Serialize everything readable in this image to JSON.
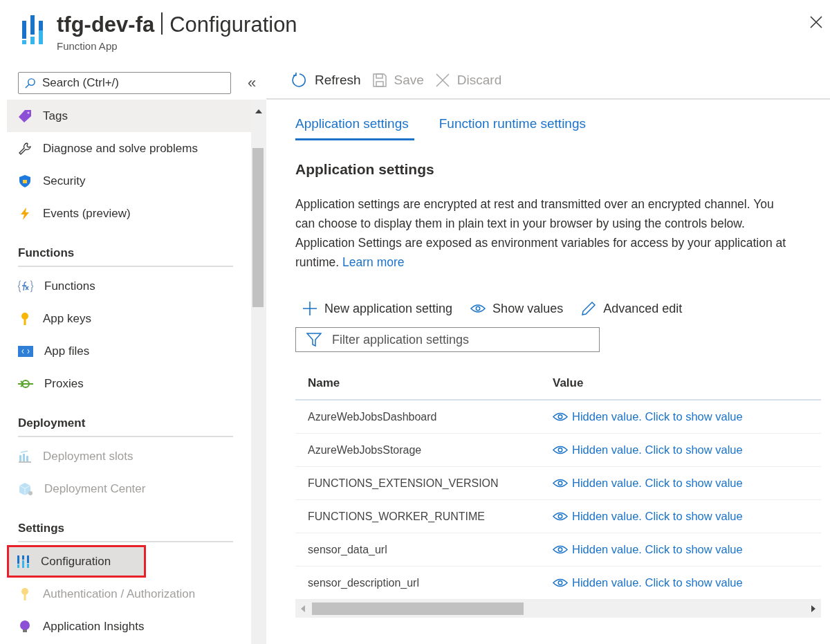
{
  "header": {
    "resource_name": "tfg-dev-fa",
    "page_title": "Configuration",
    "subtitle": "Function App"
  },
  "sidebar": {
    "search": {
      "placeholder": "Search (Ctrl+/)"
    },
    "collapse": "«",
    "items": [
      {
        "kind": "item",
        "label": "Tags",
        "disabled": false,
        "selected": false,
        "highlighted": false,
        "hovered": true
      },
      {
        "kind": "item",
        "label": "Diagnose and solve problems",
        "disabled": false,
        "selected": false,
        "highlighted": false,
        "hovered": false
      },
      {
        "kind": "item",
        "label": "Security",
        "disabled": false,
        "selected": false,
        "highlighted": false,
        "hovered": false
      },
      {
        "kind": "item",
        "label": "Events (preview)",
        "disabled": false,
        "selected": false,
        "highlighted": false,
        "hovered": false
      },
      {
        "kind": "heading",
        "label": "Functions"
      },
      {
        "kind": "item",
        "label": "Functions",
        "disabled": false,
        "selected": false,
        "highlighted": false,
        "hovered": false
      },
      {
        "kind": "item",
        "label": "App keys",
        "disabled": false,
        "selected": false,
        "highlighted": false,
        "hovered": false
      },
      {
        "kind": "item",
        "label": "App files",
        "disabled": false,
        "selected": false,
        "highlighted": false,
        "hovered": false
      },
      {
        "kind": "item",
        "label": "Proxies",
        "disabled": false,
        "selected": false,
        "highlighted": false,
        "hovered": false
      },
      {
        "kind": "heading",
        "label": "Deployment"
      },
      {
        "kind": "item",
        "label": "Deployment slots",
        "disabled": true,
        "selected": false,
        "highlighted": false,
        "hovered": false
      },
      {
        "kind": "item",
        "label": "Deployment Center",
        "disabled": true,
        "selected": false,
        "highlighted": false,
        "hovered": false
      },
      {
        "kind": "heading",
        "label": "Settings"
      },
      {
        "kind": "item",
        "label": "Configuration",
        "disabled": false,
        "selected": true,
        "highlighted": true,
        "hovered": false
      },
      {
        "kind": "item",
        "label": "Authentication / Authorization",
        "disabled": true,
        "selected": false,
        "highlighted": false,
        "hovered": false
      },
      {
        "kind": "item",
        "label": "Application Insights",
        "disabled": false,
        "selected": false,
        "highlighted": false,
        "hovered": false
      }
    ]
  },
  "toolbar": [
    {
      "label": "Refresh",
      "disabled": false
    },
    {
      "label": "Save",
      "disabled": true
    },
    {
      "label": "Discard",
      "disabled": true
    }
  ],
  "tabs": [
    {
      "label": "Application settings",
      "selected": true
    },
    {
      "label": "Function runtime settings",
      "selected": false
    }
  ],
  "section": {
    "title": "Application settings",
    "description": "Application settings are encrypted at rest and transmitted over an encrypted channel. You can choose to display them in plain text in your browser by using the controls below. Application Settings are exposed as environment variables for access by your application at runtime.",
    "link": "Learn more"
  },
  "actions": [
    {
      "label": "New application setting"
    },
    {
      "label": "Show values"
    },
    {
      "label": "Advanced edit"
    }
  ],
  "filter": {
    "placeholder": "Filter application settings"
  },
  "table": {
    "columns": [
      "Name",
      "Value"
    ],
    "rows": [
      {
        "name": "AzureWebJobsDashboard",
        "value": "Hidden value. Click to show value"
      },
      {
        "name": "AzureWebJobsStorage",
        "value": "Hidden value. Click to show value"
      },
      {
        "name": "FUNCTIONS_EXTENSION_VERSION",
        "value": "Hidden value. Click to show value"
      },
      {
        "name": "FUNCTIONS_WORKER_RUNTIME",
        "value": "Hidden value. Click to show value"
      },
      {
        "name": "sensor_data_url",
        "value": "Hidden value. Click to show value"
      },
      {
        "name": "sensor_description_url",
        "value": "Hidden value. Click to show value"
      }
    ]
  }
}
